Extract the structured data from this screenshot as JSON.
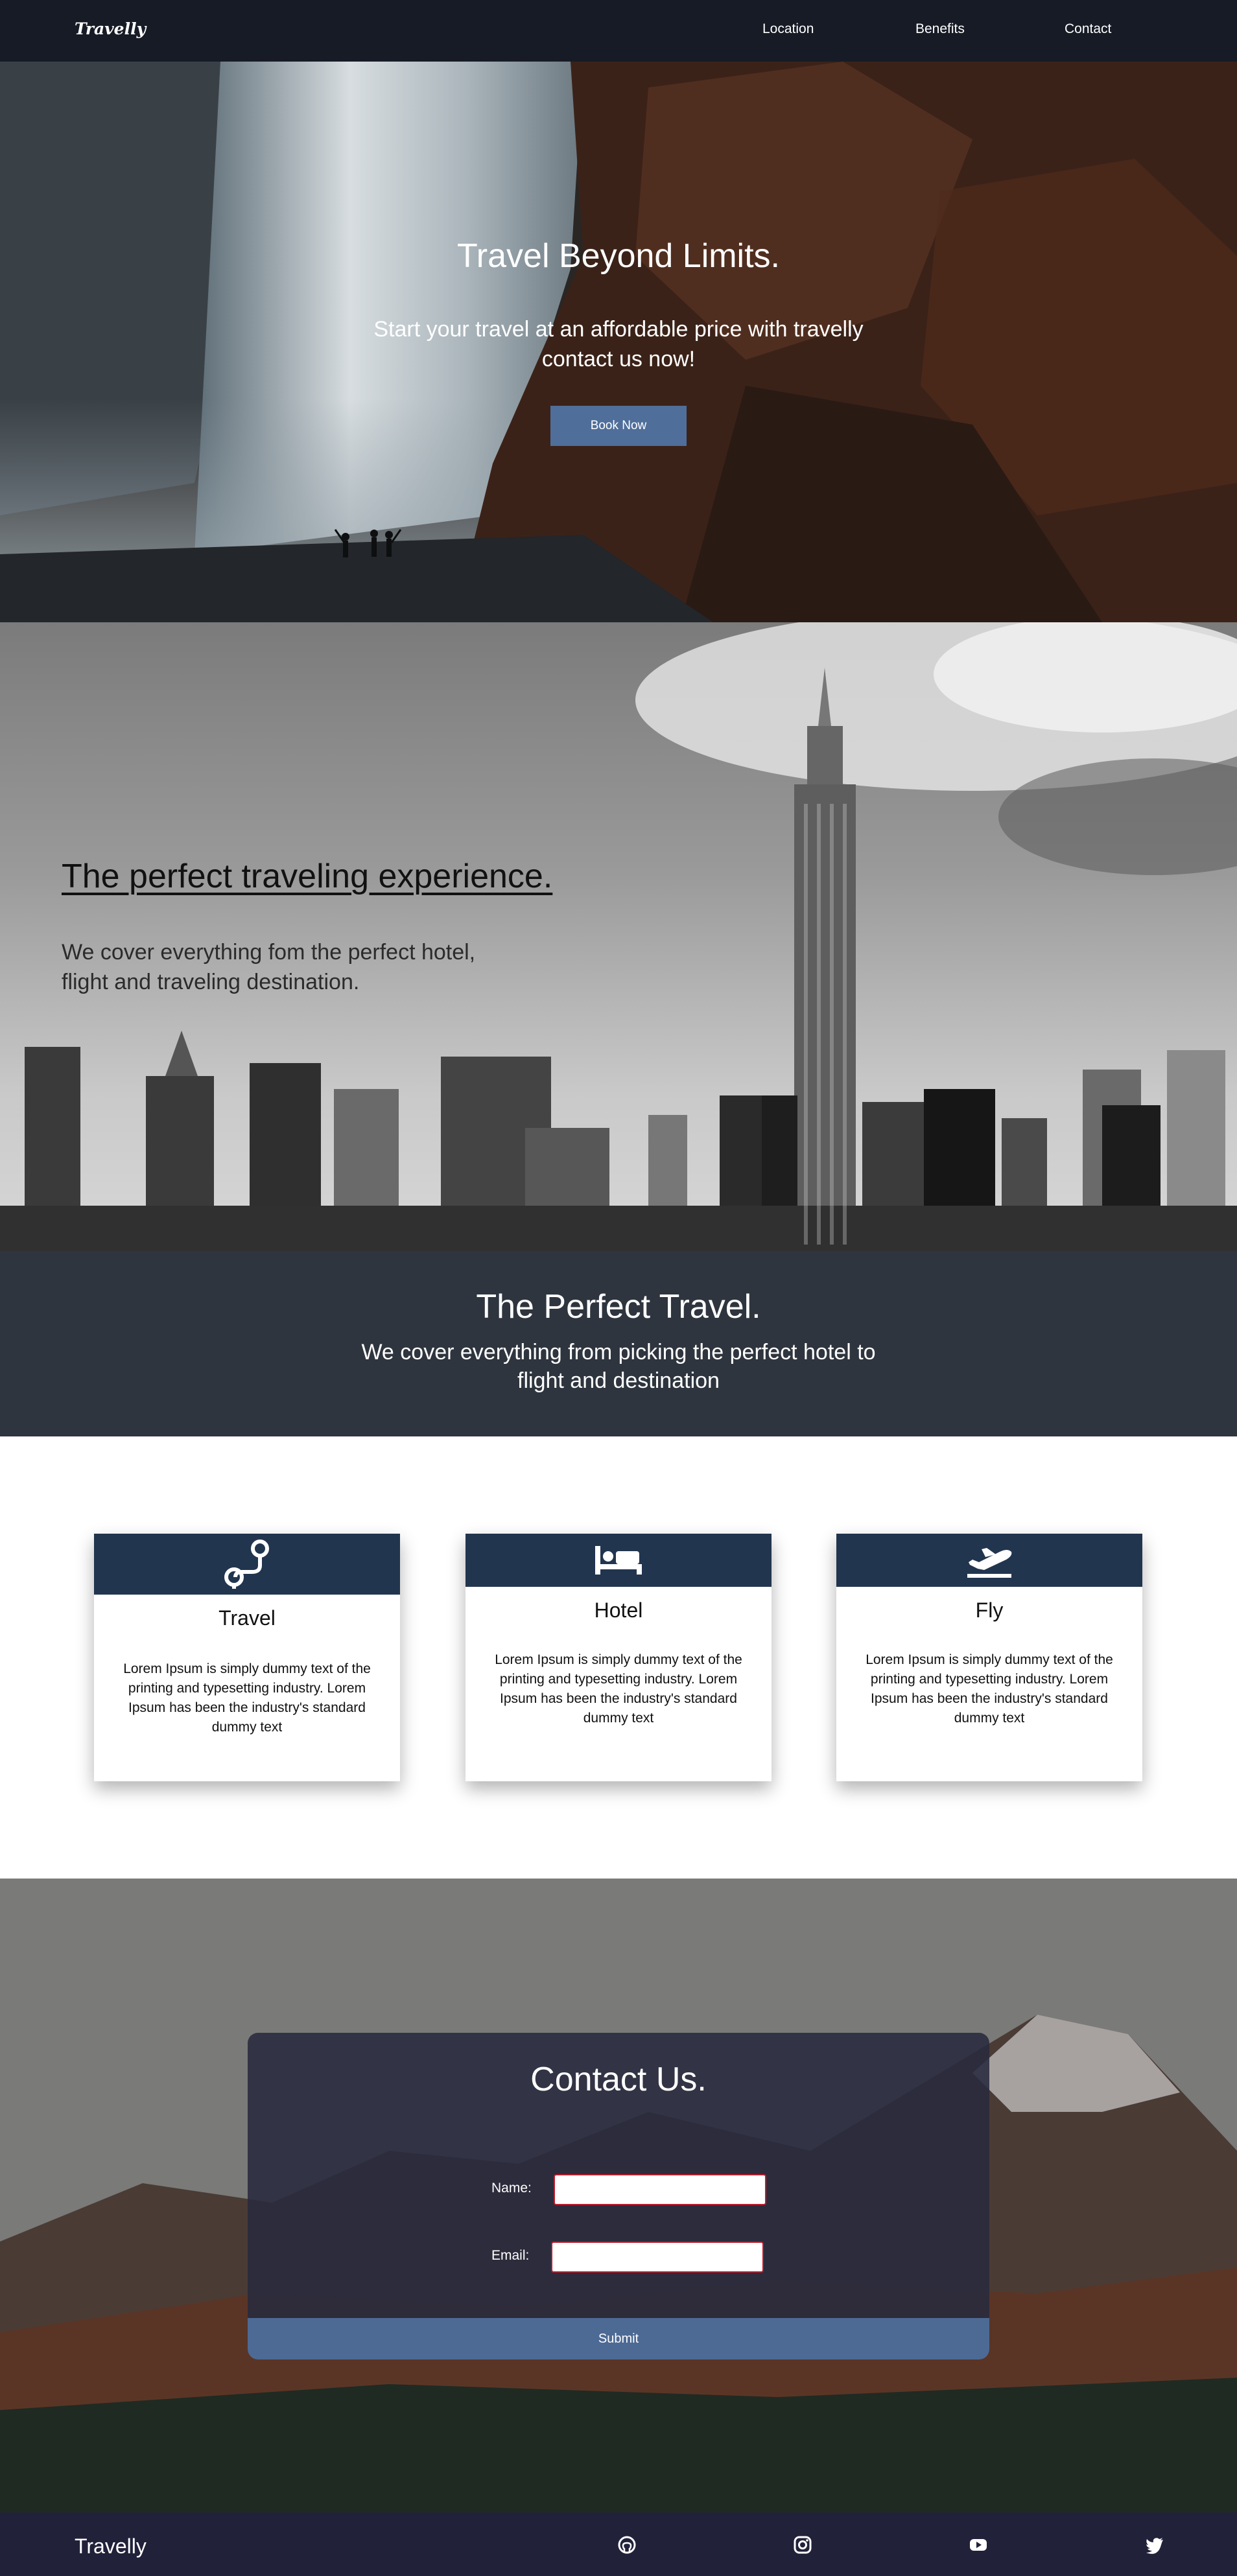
{
  "navbar": {
    "brand": "Travelly",
    "links": [
      "Location",
      "Benefits",
      "Contact"
    ]
  },
  "hero": {
    "title": "Travel Beyond Limits.",
    "subtitle": "Start your travel at an affordable price with travelly contact us now!",
    "button_label": "Book Now"
  },
  "experience": {
    "title": "The perfect traveling experience.",
    "subtitle": "We cover everything fom the perfect hotel, flight and traveling destination."
  },
  "banner": {
    "title": "The Perfect Travel.",
    "subtitle": "We cover everything from picking the perfect hotel to flight and destination"
  },
  "cards": [
    {
      "icon": "route-icon",
      "title": "Travel",
      "text": "Lorem Ipsum is simply dummy text of the printing and typesetting industry. Lorem Ipsum has been the industry's standard dummy text"
    },
    {
      "icon": "bed-icon",
      "title": "Hotel",
      "text": "Lorem Ipsum is simply dummy text of the printing and typesetting industry. Lorem Ipsum has been the industry's standard dummy text"
    },
    {
      "icon": "plane-departure-icon",
      "title": "Fly",
      "text": "Lorem Ipsum is simply dummy text of the printing and typesetting industry. Lorem Ipsum has been the industry's standard dummy text"
    }
  ],
  "contact": {
    "title": "Contact Us.",
    "name_label": "Name:",
    "email_label": "Email:",
    "name_value": "",
    "email_value": "",
    "submit_label": "Submit"
  },
  "footer": {
    "brand": "Travelly",
    "social_icons": [
      "github-icon",
      "instagram-icon",
      "youtube-icon",
      "twitter-icon"
    ]
  },
  "colors": {
    "navbar_bg": "#171b26",
    "accent_button": "#4f6e9a",
    "card_header": "#22354f",
    "banner_bg": "#2e353e",
    "footer_bg": "#21213a",
    "input_border": "#b91d2d"
  }
}
